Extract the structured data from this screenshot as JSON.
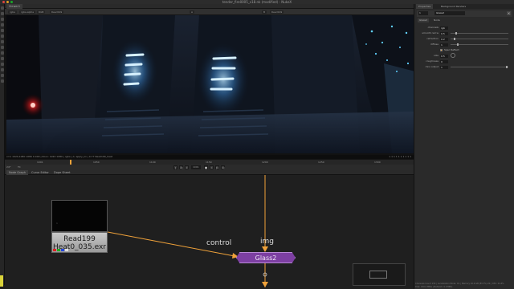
{
  "window": {
    "title": "tender_fire0005_v18.nk (modified) - NukeX"
  },
  "viewer": {
    "tabs": [
      "Viewer1"
    ],
    "toolbar_items": [
      "rgba",
      "rgba.alpha",
      "RGB",
      "Read199",
      "A",
      "B",
      "Read199"
    ],
    "info_left": "x=1 1920,1080 1080 0.000 | bbox: 1920 1080 | rgba | A: apply_lin | 0.77 Read199_heat",
    "info_right": "x 1 1 1 1 1 1 1 1 1"
  },
  "timeline": {
    "frames": [
      "1001",
      "1050",
      "1100",
      "1150",
      "1200",
      "1250",
      "1300"
    ],
    "current_frame": "1001",
    "playhead_fraction": 0.16,
    "transport": {
      "fps_label": "24*",
      "tc_label": "TC",
      "frame": "1001",
      "buttons": [
        "|<",
        "<|",
        "<",
        "■",
        ">",
        "|>",
        ">|"
      ]
    }
  },
  "nodegraph": {
    "tabs": [
      "Node Graph",
      "Curve Editor",
      "Dope Sheet"
    ],
    "read_node": {
      "label_line1": "Read199",
      "label_line2": "Heat0_035.exr",
      "thumb_label": "n"
    },
    "glass_node": {
      "label": "Glass2"
    },
    "edge_labels": {
      "control": "control",
      "img": "img"
    }
  },
  "properties": {
    "tabs": [
      "Properties",
      "Background Renders"
    ],
    "node_number": "1",
    "node_name": "Glass2",
    "subtabs": [
      "Glass2",
      "Node"
    ],
    "rows": [
      {
        "label": "channels",
        "value": "rgb"
      },
      {
        "label": "smooth rad w",
        "value": "0.5",
        "knob": 0.08
      },
      {
        "label": "refraction",
        "value": "0.2",
        "knob": 0.05
      },
      {
        "label": "diffuse",
        "value": "1",
        "knob": 0.12
      },
      {
        "label": "",
        "check_label": "Spec Reflect",
        "checked": true
      },
      {
        "label": "size",
        "value": "0.5",
        "dial": true
      },
      {
        "label": "roughness",
        "value": "0",
        "dial": true
      },
      {
        "label": "mix output",
        "value": "1",
        "knob": 0.98
      }
    ],
    "status_lines": [
      "Channels Count 130 | Localization Mode: On | Memory 16.9 GB (83.7%) 24 | CPU: 24.4%",
      "Disk: 150.0 MB/s | Network: 0.0 MB/s"
    ]
  },
  "colors": {
    "accent_orange": "#f0a23a",
    "glass_node": "#7d3fa2",
    "read_node": "#b4b4b4",
    "edge": "#f0a23a"
  }
}
